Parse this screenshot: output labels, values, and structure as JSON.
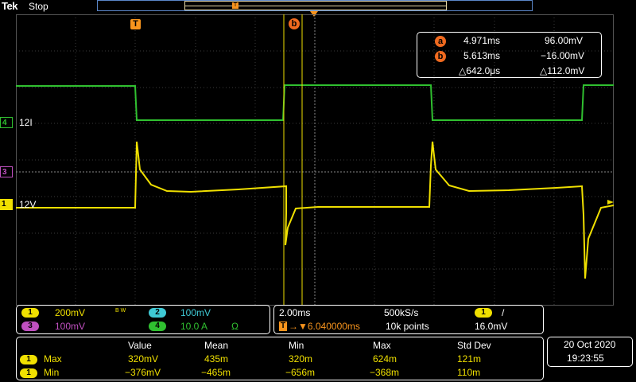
{
  "header": {
    "brand": "Tek",
    "run_status": "Stop",
    "trigger_marker_overview": "T"
  },
  "colors": {
    "ch1": "#f0e000",
    "ch2": "#3fc9d5",
    "ch3": "#c050c0",
    "ch4": "#30c030",
    "trigger": "#f7941d",
    "cursor": "#f06a1f"
  },
  "trigger_marker": "T",
  "cursor_marker_b": "b",
  "cursors": {
    "a": {
      "label": "a",
      "time": "4.971ms",
      "value": "96.00mV"
    },
    "b": {
      "label": "b",
      "time": "5.613ms",
      "value": "−16.00mV"
    },
    "delta_time": "△642.0μs",
    "delta_value": "△112.0mV"
  },
  "channels": {
    "ch4": {
      "number": "4",
      "label": "12I"
    },
    "ch3": {
      "number": "3"
    },
    "ch1": {
      "number": "1",
      "label": "12V"
    }
  },
  "vertical_panel": {
    "ch1": {
      "number": "1",
      "scale": "200mV",
      "bw": "B W"
    },
    "ch2": {
      "number": "2",
      "scale": "100mV"
    },
    "ch3": {
      "number": "3",
      "scale": "100mV"
    },
    "ch4": {
      "number": "4",
      "scale": "10.0 A",
      "unit": "Ω"
    }
  },
  "horizontal_panel": {
    "timebase": "2.00ms",
    "sample_rate": "500kS/s",
    "trigger_symbol": "T",
    "delay": "→▼6.040000ms",
    "record_length": "10k points",
    "trigger_channel": "1",
    "trigger_slope": "/",
    "trigger_level": "16.0mV"
  },
  "measurements": {
    "headers": [
      "Value",
      "Mean",
      "Min",
      "Max",
      "Std Dev"
    ],
    "rows": [
      {
        "channel": "1",
        "name": "Max",
        "value": "320mV",
        "mean": "435m",
        "min": "320m",
        "max": "624m",
        "std": "121m"
      },
      {
        "channel": "1",
        "name": "Min",
        "value": "−376mV",
        "mean": "−465m",
        "min": "−656m",
        "max": "−368m",
        "std": "110m"
      }
    ]
  },
  "datetime": {
    "date": "20 Oct  2020",
    "time": "19:23:55"
  }
}
